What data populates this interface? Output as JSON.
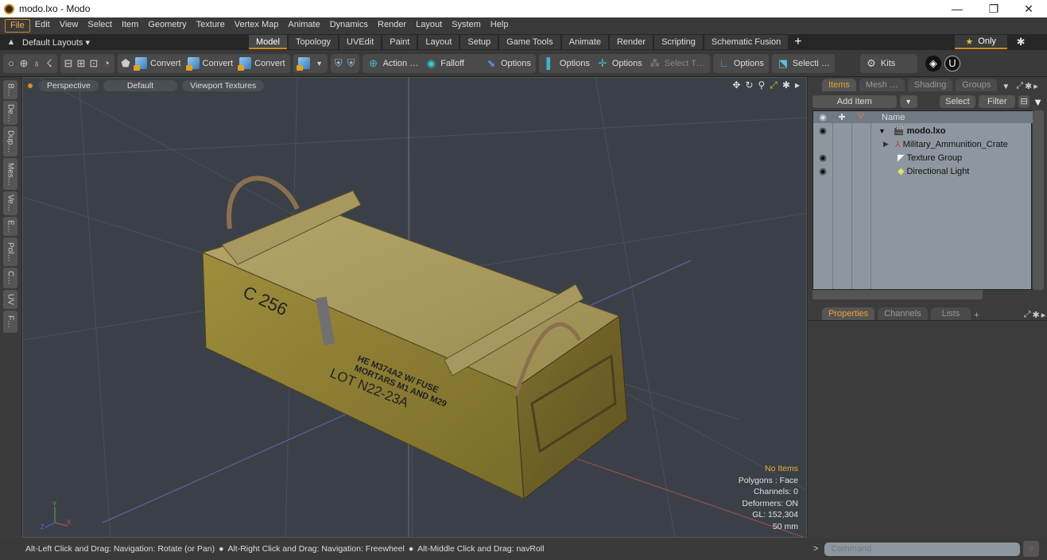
{
  "window": {
    "title": "modo.lxo - Modo",
    "controls": [
      "minimize",
      "restore",
      "close"
    ]
  },
  "menu": [
    "File",
    "Edit",
    "View",
    "Select",
    "Item",
    "Geometry",
    "Texture",
    "Vertex Map",
    "Animate",
    "Dynamics",
    "Render",
    "Layout",
    "System",
    "Help"
  ],
  "layoutbar": {
    "layouts_label": "Default Layouts ▾",
    "tabs": [
      "Model",
      "Topology",
      "UVEdit",
      "Paint",
      "Layout",
      "Setup",
      "Game Tools",
      "Animate",
      "Render",
      "Scripting",
      "Schematic Fusion"
    ],
    "active_tab": "Model",
    "add": "+",
    "only_label": "Only",
    "only_star": "★"
  },
  "toolbar": {
    "convert1": "Convert",
    "convert2": "Convert",
    "convert3": "Convert",
    "action": "Action …",
    "falloff": "Falloff",
    "options1": "Options",
    "options2": "Options",
    "options3": "Options",
    "select_t": "Select T…",
    "options4": "Options",
    "selecti": "Selecti …",
    "kits": "Kits"
  },
  "left_tabs": [
    "B…",
    "De…",
    "Dup…",
    "Mes…",
    "Ve…",
    "E…",
    "Pol…",
    "C…",
    "UV",
    "F…"
  ],
  "viewport": {
    "view": "Perspective",
    "shading": "Default",
    "textures": "Viewport Textures",
    "hud": {
      "items": "No Items",
      "polygons": "Polygons : Face",
      "channels": "Channels: 0",
      "deformers": "Deformers: ON",
      "gl": "GL: 152,304",
      "unit": "50 mm"
    },
    "crate_text": {
      "side": "C 256",
      "line1": "HE M374A2 W/ FUSE",
      "line2": "MORTARS M1 AND M29",
      "line3": "LOT N22-23A"
    },
    "axis": {
      "y": "Y",
      "z": "Z",
      "x": "X"
    }
  },
  "items_panel": {
    "tabs": [
      "Items",
      "Mesh …",
      "Shading",
      "Groups"
    ],
    "active_tab": "Items",
    "add_item": "Add Item",
    "select": "Select",
    "filter": "Filter",
    "column_name": "Name",
    "tree": [
      {
        "label": "modo.lxo",
        "visible": true,
        "bold": true
      },
      {
        "label": "Military_Ammunition_Crate",
        "visible": false
      },
      {
        "label": "Texture Group",
        "visible": true
      },
      {
        "label": "Directional Light",
        "visible": true
      }
    ]
  },
  "properties_panel": {
    "tabs": [
      "Properties",
      "Channels",
      "Lists"
    ],
    "active_tab": "Properties",
    "add": "+"
  },
  "statusbar": {
    "hint1": "Alt-Left Click and Drag: Navigation: Rotate (or Pan)",
    "hint2": "Alt-Right Click and Drag: Navigation: Freewheel",
    "hint3": "Alt-Middle Click and Drag: navRoll"
  },
  "command": {
    "placeholder": "Command",
    "prompt": ">"
  }
}
